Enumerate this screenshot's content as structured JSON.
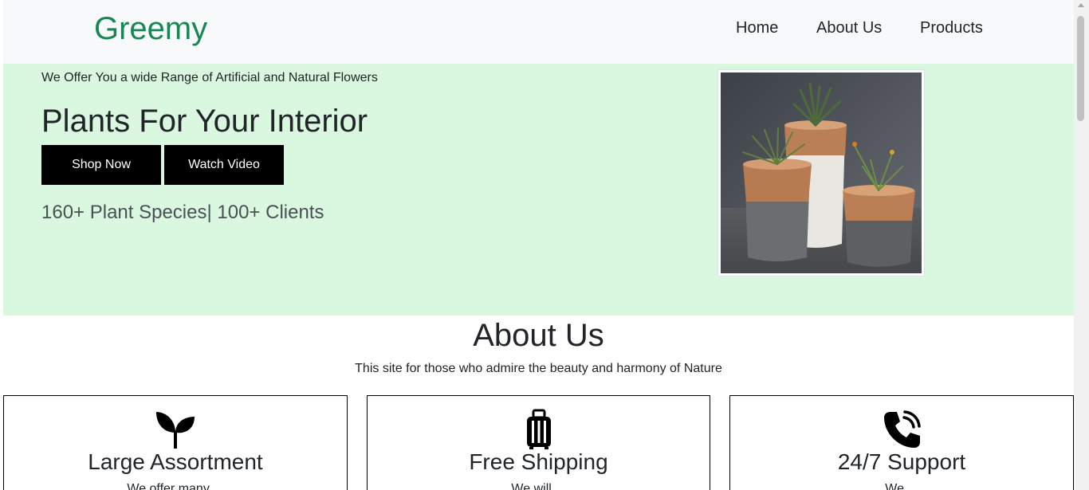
{
  "navbar": {
    "brand": "Greemy",
    "links": [
      "Home",
      "About Us",
      "Products"
    ]
  },
  "hero": {
    "tagline": "We Offer You a wide Range of Artificial and Natural Flowers",
    "title": "Plants For Your Interior",
    "buttons": {
      "shop": "Shop Now",
      "watch": "Watch Video"
    },
    "stats": "160+ Plant Species| 100+ Clients"
  },
  "about": {
    "title": "About Us",
    "subtitle": "This site for those who admire the beauty and harmony of Nature",
    "cards": [
      {
        "icon": "sprout-icon",
        "title": "Large Assortment",
        "text": "We offer many ..."
      },
      {
        "icon": "luggage-icon",
        "title": "Free Shipping",
        "text": "We will ..."
      },
      {
        "icon": "phone-call-icon",
        "title": "24/7 Support",
        "text": "We ..."
      }
    ]
  },
  "colors": {
    "brand": "#198754",
    "hero_bg": "#d9f8df",
    "navbar_bg": "#f8f9fa",
    "button_bg": "#000000",
    "button_text": "#ffffff"
  }
}
